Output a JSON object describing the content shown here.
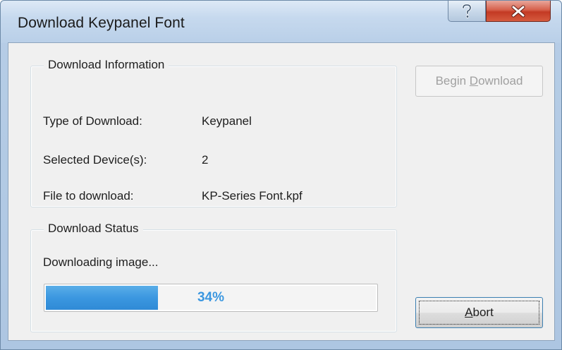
{
  "window": {
    "title": "Download Keypanel Font",
    "help_glyph": "?",
    "close_glyph": "X",
    "colors": {
      "close": "#c33a24",
      "titlebar": "#c6d9ee",
      "face": "#f0f0f0",
      "progress": "#3b97e0"
    }
  },
  "info_group": {
    "legend": "Download Information",
    "fields": [
      {
        "label": "Type of Download:",
        "value": "Keypanel"
      },
      {
        "label": "Selected Device(s):",
        "value": "2"
      },
      {
        "label": "File to download:",
        "value": "KP-Series Font.kpf"
      }
    ]
  },
  "status_group": {
    "legend": "Download Status",
    "message": "Downloading image...",
    "progress_value": 34,
    "progress_text": "34%"
  },
  "buttons": {
    "begin": {
      "pre": "Begin ",
      "accel": "D",
      "post": "ownload",
      "enabled": false
    },
    "abort": {
      "pre": "",
      "accel": "A",
      "post": "bort",
      "focused": true
    }
  }
}
